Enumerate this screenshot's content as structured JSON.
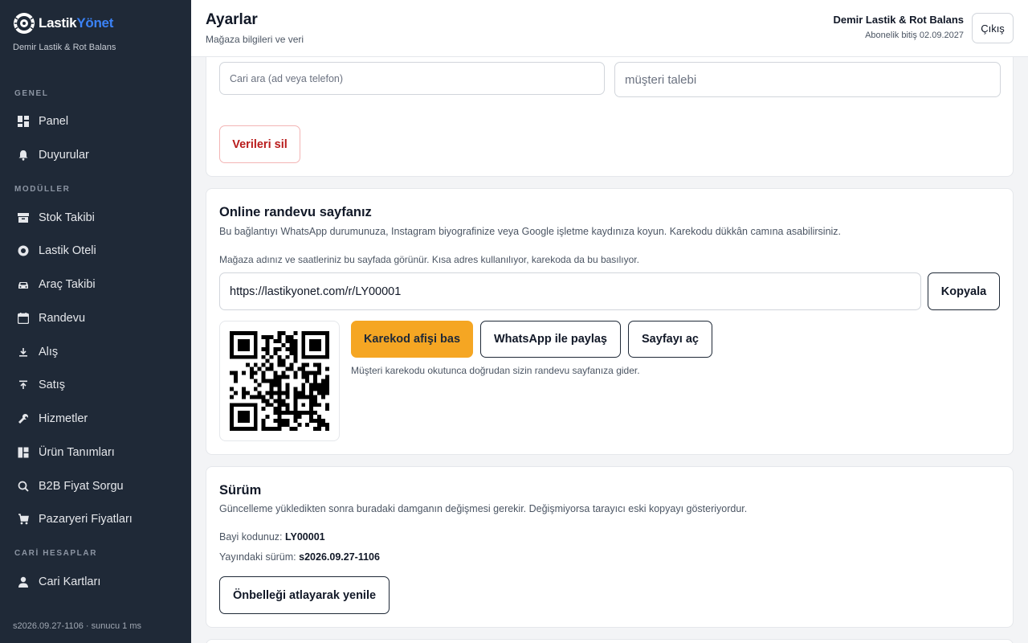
{
  "brand": {
    "name_part1": "Lastik",
    "name_part2": "Yönet",
    "subtitle": "Demir Lastik & Rot Balans",
    "accent": "#3b82f6"
  },
  "sidebar": {
    "sections": [
      {
        "label": "GENEL"
      },
      {
        "label": "MODÜLLER"
      },
      {
        "label": "CARİ HESAPLAR"
      }
    ],
    "items": [
      {
        "label": "Panel",
        "icon": "dashboard-icon"
      },
      {
        "label": "Duyurular",
        "icon": "bell-icon"
      },
      {
        "label": "Stok Takibi",
        "icon": "warehouse-icon"
      },
      {
        "label": "Lastik Oteli",
        "icon": "tire-icon"
      },
      {
        "label": "Araç Takibi",
        "icon": "car-icon"
      },
      {
        "label": "Randevu",
        "icon": "calendar-icon"
      },
      {
        "label": "Alış",
        "icon": "download-icon"
      },
      {
        "label": "Satış",
        "icon": "upload-icon"
      },
      {
        "label": "Hizmetler",
        "icon": "wrench-icon"
      },
      {
        "label": "Ürün Tanımları",
        "icon": "grid-icon"
      },
      {
        "label": "B2B Fiyat Sorgu",
        "icon": "search-icon"
      },
      {
        "label": "Pazaryeri Fiyatları",
        "icon": "cart-icon"
      },
      {
        "label": "Cari Kartları",
        "icon": "person-icon"
      }
    ],
    "footer": "s2026.09.27-1106 · sunucu 1 ms"
  },
  "header": {
    "title": "Ayarlar",
    "subtitle": "Mağaza bilgileri ve veri",
    "store_name": "Demir Lastik & Rot Balans",
    "subscription": "Abonelik bitiş 02.09.2027",
    "logout_label": "Çıkış"
  },
  "data_card": {
    "search_placeholder": "Cari ara (ad veya telefon)",
    "request_placeholder": "müşteri talebi",
    "delete_label": "Verileri sil"
  },
  "booking_card": {
    "title": "Online randevu sayfanız",
    "description": "Bu bağlantıyı WhatsApp durumunuza, Instagram biyografinize veya Google işletme kaydınıza koyun. Karekodu dükkân camına asabilirsiniz.",
    "note": "Mağaza adınız ve saatleriniz bu sayfada görünür. Kısa adres kullanılıyor, karekoda da bu basılıyor.",
    "url": "https://lastikyonet.com/r/LY00001",
    "copy_label": "Kopyala",
    "print_label": "Karekod afişi bas",
    "whatsapp_label": "WhatsApp ile paylaş",
    "open_label": "Sayfayı aç",
    "qr_hint": "Müşteri karekodu okutunca doğrudan sizin randevu sayfanıza gider."
  },
  "version_card": {
    "title": "Sürüm",
    "description": "Güncelleme yükledikten sonra buradaki damganın değişmesi gerekir. Değişmiyorsa tarayıcı eski kopyayı gösteriyordur.",
    "dealer_label": "Bayi kodunuz:",
    "dealer_code": "LY00001",
    "version_label": "Yayındaki sürüm:",
    "version_value": "s2026.09.27-1106",
    "reload_label": "Önbelleği atlayarak yenile"
  },
  "colors": {
    "sidebar_bg": "#1f2937",
    "primary": "#f5a623",
    "danger": "#b91c1c"
  }
}
